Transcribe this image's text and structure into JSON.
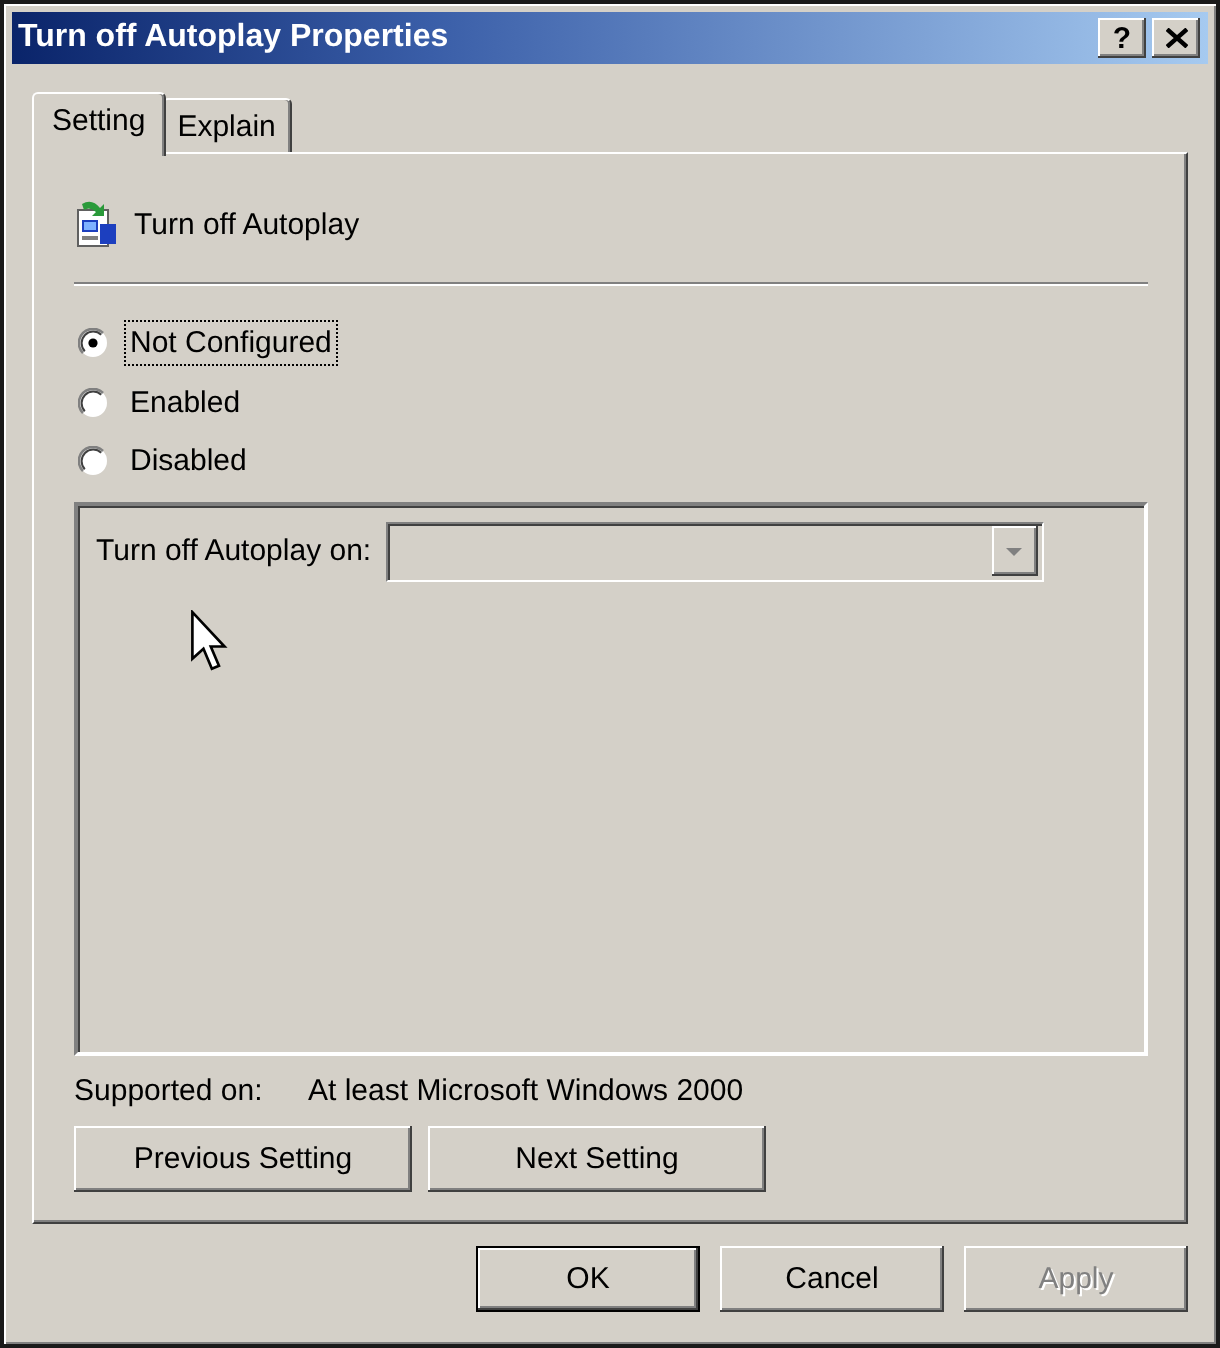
{
  "window": {
    "title": "Turn off Autoplay Properties",
    "help_button": {
      "label": "?"
    }
  },
  "tabs": [
    {
      "label": "Setting",
      "selected": true
    },
    {
      "label": "Explain",
      "selected": false
    }
  ],
  "policy": {
    "name": "Turn off Autoplay"
  },
  "options": [
    {
      "label": "Not Configured",
      "selected": true,
      "focused": true
    },
    {
      "label": "Enabled",
      "selected": false,
      "focused": false
    },
    {
      "label": "Disabled",
      "selected": false,
      "focused": false
    }
  ],
  "options_panel": {
    "fields": [
      {
        "kind": "dropdown",
        "label": "Turn off Autoplay on:",
        "disabled": true
      }
    ]
  },
  "supported_on": {
    "label": "Supported on:",
    "value": "At least Microsoft Windows 2000"
  },
  "nav_buttons": [
    {
      "label": "Previous Setting"
    },
    {
      "label": "Next Setting"
    }
  ],
  "dialog_buttons": [
    {
      "label": "OK",
      "default": true,
      "disabled": false
    },
    {
      "label": "Cancel",
      "default": false,
      "disabled": false
    },
    {
      "label": "Apply",
      "default": false,
      "disabled": true
    }
  ]
}
